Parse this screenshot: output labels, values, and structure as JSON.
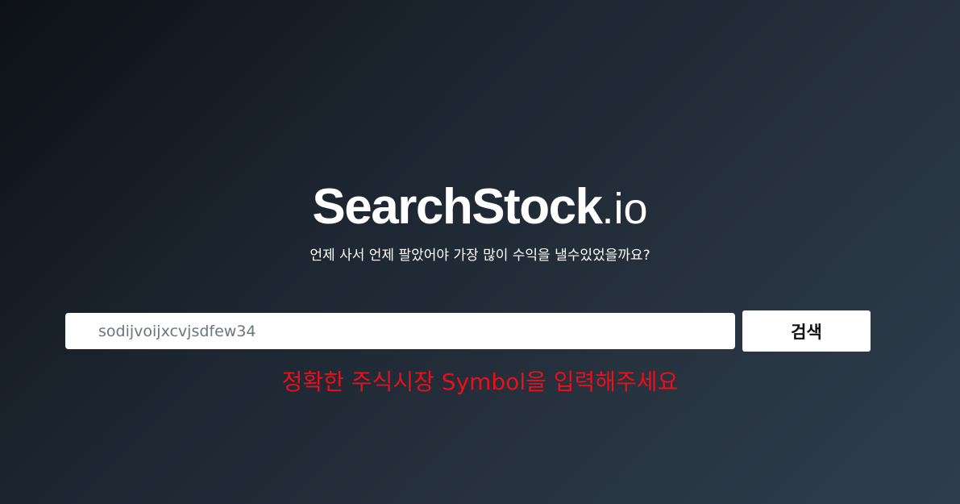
{
  "brand": {
    "name": "SearchStock",
    "extension": ".io"
  },
  "tagline": "언제 사서 언제 팔았어야 가장 많이 수익을 낼수있었을까요?",
  "search": {
    "value": "sodijvoijxcvjsdfew34",
    "button_label": "검색"
  },
  "error_message": "정확한 주식시장 Symbol을 입력해주세요",
  "colors": {
    "background_start": "#0d1117",
    "background_end": "#2e3d4e",
    "error": "#e8101a",
    "text": "#ffffff"
  }
}
